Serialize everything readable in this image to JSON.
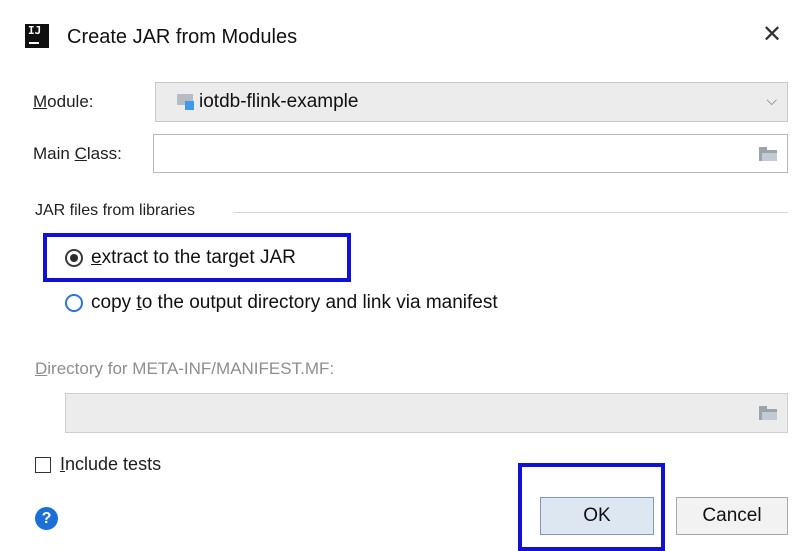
{
  "dialog": {
    "title": "Create JAR from Modules",
    "app_icon_text": "IJ",
    "close_glyph": "✕"
  },
  "module": {
    "label": "Module:",
    "value": "iotdb-flink-example",
    "dropdown_glyph": "⌵",
    "icon": "module-folder-icon"
  },
  "main_class": {
    "label": "Main Class:",
    "value": "",
    "browse_icon": "folder-icon"
  },
  "jar_group": {
    "title": "JAR files from libraries",
    "options": [
      {
        "label": "extract to the target JAR",
        "selected": true
      },
      {
        "label": "copy to the output directory and link via manifest",
        "selected": false
      }
    ]
  },
  "manifest": {
    "label": "Directory for META-INF/MANIFEST.MF:",
    "value": "",
    "enabled": false,
    "browse_icon": "folder-icon"
  },
  "include_tests": {
    "label": "Include tests",
    "checked": false
  },
  "footer": {
    "help_glyph": "?",
    "ok_label": "OK",
    "cancel_label": "Cancel"
  },
  "colors": {
    "annotation_box": "#1010d6",
    "help_icon": "#1b6fd6",
    "radio_unchecked_border": "#2e73d6",
    "module_icon_accent": "#3d9be9"
  }
}
